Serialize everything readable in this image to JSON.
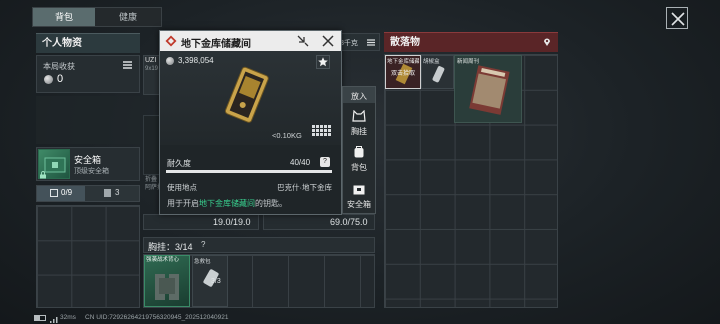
{
  "tabs": [
    "背包",
    "健康"
  ],
  "personal": {
    "title": "个人物资",
    "earnings_label": "本局收获",
    "earnings_value": "0",
    "weapon_label": "UZI",
    "weapon_sub": "9x19",
    "safe_box_name": "安全箱",
    "safe_box_desc": "顶级安全箱",
    "count_a": "0/9",
    "count_b": "3"
  },
  "popup": {
    "title": "地下金库储藏间",
    "price": "3,398,054",
    "weight": "<0.10KG",
    "durability_label": "耐久度",
    "durability_value": "40/40",
    "location_label": "使用地点",
    "location_value": "巴克什·地下金库",
    "desc_prefix": "用于开启",
    "desc_highlight": "地下金库储藏间",
    "desc_suffix": "的钥匙。",
    "durability_fraction": 1.0
  },
  "side_actions": [
    "放入",
    "胸挂",
    "背包",
    "安全箱"
  ],
  "bottom_values": [
    "19.0/19.0",
    "69.0/75.0"
  ],
  "chest": {
    "title": "胸挂：3/14",
    "item1": "强袭战术背心",
    "item2_name": "急救包",
    "item2_count": "3/3"
  },
  "loot": {
    "title": "散落物",
    "item1": "地下金库储藏间",
    "item1_sub": "双击拾取",
    "item2": "胡椒盒",
    "item3": "新闻周刊"
  },
  "behind_label": "8千克",
  "hint_label": "折叠",
  "hint_label2": "阿萨拉",
  "footer": {
    "ping": "32ms",
    "uid": "CN UID:729262642197563209​45_202512040921"
  },
  "colors": {
    "accent_red": "#7a2628",
    "accent_green": "#39d08f",
    "panel_header": "#2c3a3e",
    "popup_bg": "#ececec"
  }
}
